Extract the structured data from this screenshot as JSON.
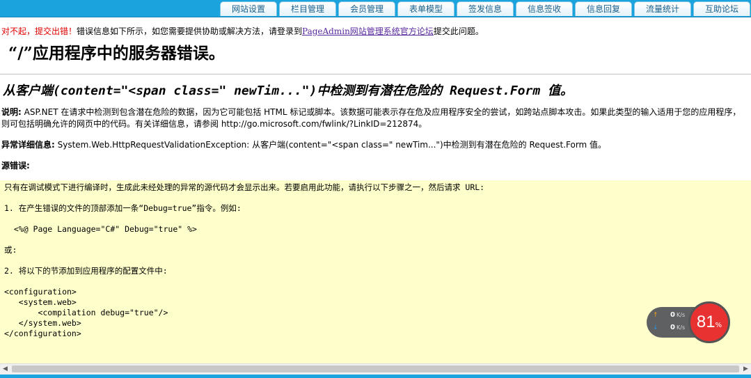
{
  "nav": {
    "tabs": [
      "网站设置",
      "栏目管理",
      "会员管理",
      "表单模型",
      "签发信息",
      "信息签收",
      "信息回复",
      "流量统计",
      "互助论坛"
    ]
  },
  "notice": {
    "warning": "对不起，提交出错！",
    "text_before_link": "错误信息如下所示，如您需要提供协助或解决方法，请登录到",
    "link": "PageAdmin网站管理系统官方论坛",
    "text_after_link": "提交此问题。"
  },
  "error": {
    "title": "“/”应用程序中的服务器错误。",
    "subtitle": "从客户端(content=\"<span class=\" newTim...\")中检测到有潜在危险的 Request.Form 值。",
    "description_label": "说明:",
    "description": " ASP.NET 在请求中检测到包含潜在危险的数据，因为它可能包括 HTML 标记或脚本。该数据可能表示存在危及应用程序安全的尝试，如跨站点脚本攻击。如果此类型的输入适用于您的应用程序，则可包括明确允许的网页中的代码。有关详细信息，请参阅 http://go.microsoft.com/fwlink/?LinkID=212874。",
    "exception_label": "异常详细信息:",
    "exception": " System.Web.HttpRequestValidationException: 从客户端(content=\"<span class=\" newTim...\")中检测到有潜在危险的 Request.Form 值。",
    "source_label": "源错误:"
  },
  "code": {
    "line1": "只有在调试模式下进行编译时，生成此未经处理的异常的源代码才会显示出来。若要启用此功能，请执行以下步骤之一，然后请求 URL:",
    "line2": "1. 在产生错误的文件的顶部添加一条“Debug=true”指令。例如:",
    "line3": "  <%@ Page Language=\"C#\" Debug=\"true\" %>",
    "line4": "或:",
    "line5": "2. 将以下的节添加到应用程序的配置文件中:",
    "line6": "<configuration>",
    "line7": "   <system.web>",
    "line8": "       <compilation debug=\"true\"/>",
    "line9": "   </system.web>",
    "line10": "</configuration>"
  },
  "widget": {
    "upload_value": "0",
    "upload_unit": "K/s",
    "download_value": "0",
    "download_unit": "K/s",
    "gauge_value": "81",
    "gauge_unit": "%",
    "up_icon": "arrow-up-icon",
    "down_icon": "arrow-down-icon"
  },
  "colors": {
    "topbar": "#1aa3dc",
    "code_bg": "#ffffcc",
    "warning": "#e00000",
    "gauge": "#e83232"
  }
}
